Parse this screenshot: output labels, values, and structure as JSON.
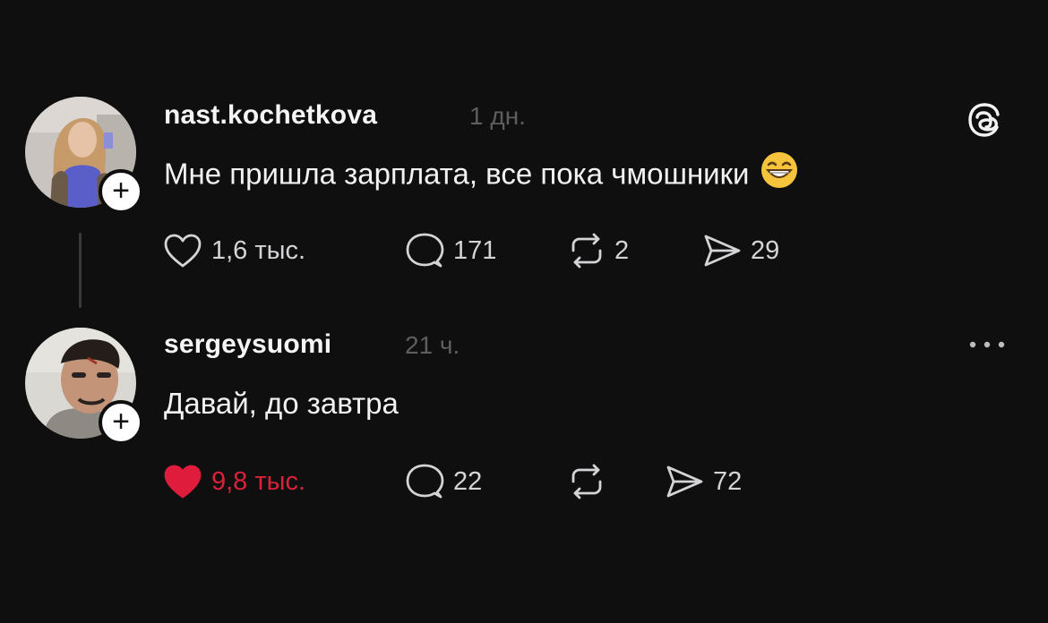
{
  "posts": [
    {
      "username": "nast.kochetkova",
      "time": "1 дн.",
      "text": "Мне пришла зарплата, все пока чмошники",
      "emoji": "grinning-face",
      "likes": "1,6 тыс.",
      "liked": false,
      "comments": "171",
      "reposts": "2",
      "shares": "29"
    },
    {
      "username": "sergeysuomi",
      "time": "21 ч.",
      "text": "Давай, до завтра",
      "likes": "9,8 тыс.",
      "liked": true,
      "comments": "22",
      "reposts": "",
      "shares": "72"
    }
  ],
  "colors": {
    "background": "#0f0f10",
    "liked": "#d9213a",
    "muted": "#5e5e61",
    "text": "#f2f2f2"
  },
  "icons": [
    "threads-logo-icon",
    "more-options-icon",
    "heart-icon",
    "comment-icon",
    "repost-icon",
    "share-icon",
    "follow-plus-icon"
  ]
}
